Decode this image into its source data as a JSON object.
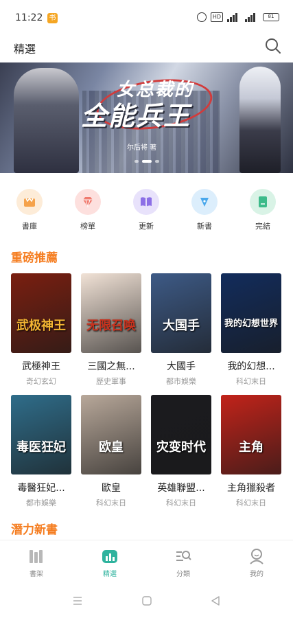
{
  "status_bar": {
    "time": "11:22",
    "app_badge": "书",
    "hd": "HD",
    "signal1": "4G",
    "signal2": "4G",
    "battery": "81"
  },
  "header": {
    "title": "精選"
  },
  "banner": {
    "title_top": "女总裁的",
    "title_main": "全能兵王",
    "subtitle": "尔后将 著"
  },
  "categories": [
    {
      "label": "書庫",
      "icon": "library-icon",
      "bg": "#fdecd8",
      "color": "#f5a24a"
    },
    {
      "label": "榜單",
      "icon": "diamond-icon",
      "bg": "#fde0de",
      "color": "#f07a6e"
    },
    {
      "label": "更新",
      "icon": "open-book-icon",
      "bg": "#e8e2fb",
      "color": "#8c6fe6"
    },
    {
      "label": "新書",
      "icon": "pen-nib-icon",
      "bg": "#dceefc",
      "color": "#4aa8ec"
    },
    {
      "label": "完結",
      "icon": "completed-book-icon",
      "bg": "#d9f3e6",
      "color": "#3dbb8a"
    }
  ],
  "sections": {
    "featured": "重磅推薦",
    "potential": "潛力新書"
  },
  "books": [
    {
      "title": "武極神王",
      "genre": "奇幻玄幻",
      "cover_text": "武极神王",
      "cover_bg": "#7a1f10",
      "cover_accent": "#f4b533"
    },
    {
      "title": "三國之無...",
      "genre": "歷史軍事",
      "cover_text": "无限召唤",
      "cover_bg": "#f1e2d6",
      "cover_accent": "#c8331f"
    },
    {
      "title": "大國手",
      "genre": "都市娛樂",
      "cover_text": "大国手",
      "cover_bg": "#3d5a86",
      "cover_accent": "#ffffff"
    },
    {
      "title": "我的幻想...",
      "genre": "科幻末日",
      "cover_text": "我的幻想世界",
      "cover_bg": "#122c5c",
      "cover_accent": "#ffffff"
    },
    {
      "title": "毒醫狂妃...",
      "genre": "都市娛樂",
      "cover_text": "毒医狂妃",
      "cover_bg": "#2f6d8a",
      "cover_accent": "#ffffff"
    },
    {
      "title": "歐皇",
      "genre": "科幻末日",
      "cover_text": "欧皇",
      "cover_bg": "#b8a89a",
      "cover_accent": "#ffffff"
    },
    {
      "title": "英雄聯盟...",
      "genre": "科幻末日",
      "cover_text": "灾变时代",
      "cover_bg": "#1b1b1f",
      "cover_accent": "#ffffff"
    },
    {
      "title": "主角獵殺者",
      "genre": "科幻末日",
      "cover_text": "主角",
      "cover_bg": "#c2231a",
      "cover_accent": "#ffffff"
    }
  ],
  "bottom_nav": [
    {
      "label": "書架",
      "icon": "bookshelf-icon",
      "active": false
    },
    {
      "label": "精選",
      "icon": "featured-icon",
      "active": true
    },
    {
      "label": "分類",
      "icon": "category-search-icon",
      "active": false
    },
    {
      "label": "我的",
      "icon": "profile-icon",
      "active": false
    }
  ],
  "colors": {
    "accent": "#f57d20",
    "active_tab": "#2fb39e"
  }
}
